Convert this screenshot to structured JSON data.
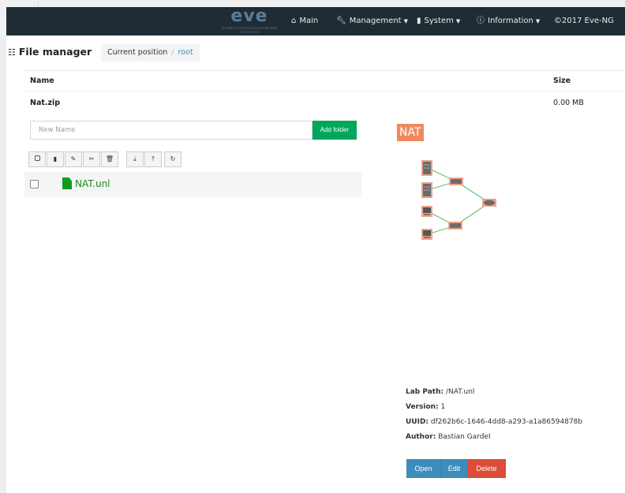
{
  "navbar": {
    "logo_text": "eve",
    "logo_tagline": "Emulated Virtual Environment Next Generation",
    "items": [
      {
        "label": "Main",
        "icon": "home-icon",
        "caret": false
      },
      {
        "label": "Management",
        "icon": "wrench-icon",
        "caret": true
      },
      {
        "label": "System",
        "icon": "book-icon",
        "caret": true
      },
      {
        "label": "Information",
        "icon": "info-circle-icon",
        "caret": true
      },
      {
        "label": "©2017 Eve-NG",
        "icon": "",
        "caret": false
      }
    ]
  },
  "file_manager": {
    "title": "File manager",
    "breadcrumb": {
      "prefix": "Current position",
      "separator": "/",
      "current": "root"
    }
  },
  "clipboard_table": {
    "headers": {
      "name": "Name",
      "size": "Size"
    },
    "rows": [
      {
        "name": "Nat.zip",
        "size": "0.00 MB"
      }
    ]
  },
  "new_folder": {
    "placeholder": "New Name",
    "button_label": "Add folder"
  },
  "toolbar": {
    "buttons": [
      "select-all",
      "new-file",
      "rename",
      "cut",
      "delete",
      "import",
      "export",
      "refresh"
    ]
  },
  "files": [
    {
      "name": "NAT.unl",
      "icon": "file-icon"
    }
  ],
  "preview": {
    "lab_badge": "NAT",
    "details": [
      {
        "label": "Lab Path:",
        "value": "/NAT.unl"
      },
      {
        "label": "Version:",
        "value": "1"
      },
      {
        "label": "UUID:",
        "value": "df262b6c-1646-4dd8-a293-a1a86594878b"
      },
      {
        "label": "Author:",
        "value": "Bastian Gardel"
      }
    ],
    "actions": {
      "open": "Open",
      "edit": "Edit",
      "delete": "Delete"
    }
  },
  "colors": {
    "navbar_bg": "#1f2c34",
    "primary": "#3c8dbc",
    "success": "#00a65a",
    "danger": "#dd4b39",
    "lab_badge": "#f08a5d",
    "file_green": "#1a8a24"
  }
}
